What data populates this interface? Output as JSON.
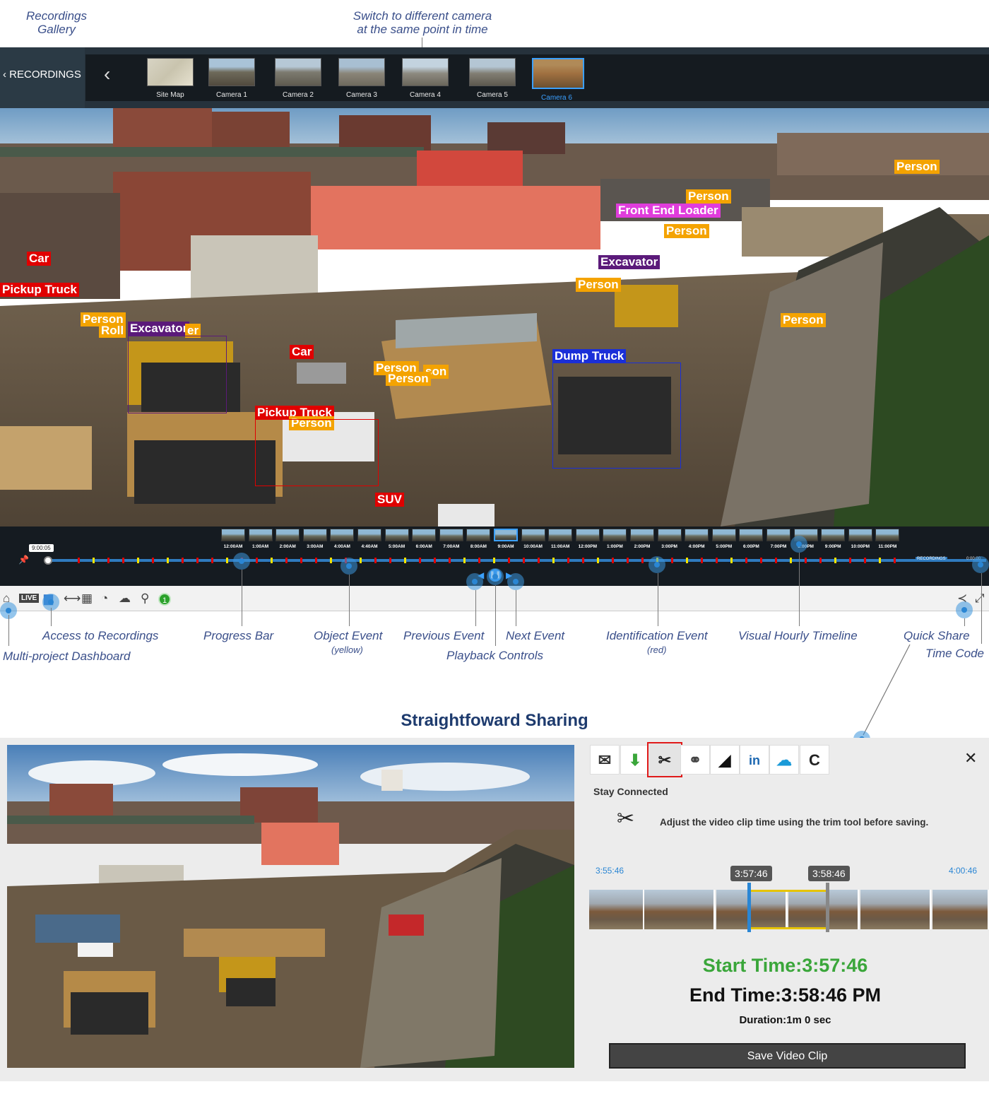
{
  "callouts": {
    "recordings_gallery": "Recordings\nGallery",
    "switch_camera": "Switch to different camera\nat the same point in time",
    "access_recordings": "Access to Recordings",
    "multi_project": "Multi-project Dashboard",
    "progress_bar": "Progress Bar",
    "object_event": "Object Event",
    "object_event_sub": "(yellow)",
    "previous_event": "Previous Event",
    "playback_controls": "Playback Controls",
    "next_event": "Next Event",
    "identification_event": "Identification Event",
    "identification_event_sub": "(red)",
    "visual_hourly": "Visual Hourly Timeline",
    "quick_share": "Quick Share",
    "time_code": "Time Code"
  },
  "topbar": {
    "recordings_label": "RECORDINGS",
    "cameras": [
      {
        "label": "Site Map"
      },
      {
        "label": "Camera 1"
      },
      {
        "label": "Camera 2"
      },
      {
        "label": "Camera 3"
      },
      {
        "label": "Camera 4"
      },
      {
        "label": "Camera 5"
      },
      {
        "label": "Camera 6"
      }
    ],
    "active_camera": "Camera 6"
  },
  "detections": [
    {
      "label": "Person",
      "color": "orange"
    },
    {
      "label": "Person",
      "color": "orange"
    },
    {
      "label": "Front End Loader",
      "color": "pink"
    },
    {
      "label": "Person",
      "color": "orange"
    },
    {
      "label": "Car",
      "color": "red"
    },
    {
      "label": "Excavator",
      "color": "purple"
    },
    {
      "label": "Pickup Truck",
      "color": "red"
    },
    {
      "label": "Person",
      "color": "orange"
    },
    {
      "label": "Person",
      "color": "orange"
    },
    {
      "label": "Person",
      "color": "orange"
    },
    {
      "label": "Roll",
      "color": "orange"
    },
    {
      "label": "Excavator",
      "color": "purple"
    },
    {
      "label": "er",
      "color": "orange"
    },
    {
      "label": "Car",
      "color": "red"
    },
    {
      "label": "Person",
      "color": "orange"
    },
    {
      "label": "son",
      "color": "orange"
    },
    {
      "label": "Person",
      "color": "orange"
    },
    {
      "label": "Dump Truck",
      "color": "blue"
    },
    {
      "label": "Pickup Truck",
      "color": "red"
    },
    {
      "label": "Person",
      "color": "orange"
    },
    {
      "label": "SUV",
      "color": "red"
    }
  ],
  "timeline": {
    "time_code": "9:00:05",
    "hours": [
      "12:00AM",
      "1:00AM",
      "2:00AM",
      "3:00AM",
      "4:00AM",
      "4:40AM",
      "5:00AM",
      "6:00AM",
      "7:00AM",
      "8:00AM",
      "9:00AM",
      "10:00AM",
      "11:00AM",
      "12:00PM",
      "1:00PM",
      "2:00PM",
      "3:00PM",
      "4:00PM",
      "5:00PM",
      "6:00PM",
      "7:00PM",
      "8:00PM",
      "9:00PM",
      "10:00PM",
      "11:00PM"
    ],
    "active_hour": "9:00AM",
    "recordings_tag": "RECORDINGS",
    "end_code": "0:00:00",
    "progress": 0.0
  },
  "toolbar": {
    "live_label": "LIVE",
    "badge": "1"
  },
  "share": {
    "title": "Straightfoward Sharing",
    "stay_connected": "Stay Connected",
    "instruction": "Adjust the video clip time using the trim tool before saving.",
    "range_start": "3:55:46",
    "range_end": "4:00:46",
    "trim_start_tag": "3:57:46",
    "trim_end_tag": "3:58:46",
    "start_time": "Start Time:3:57:46",
    "end_time": "End Time:3:58:46 PM",
    "duration_label": "Duration:",
    "duration_value": "1m 0 sec",
    "save_label": "Save Video Clip",
    "close": "✕"
  },
  "colors": {
    "accent": "#3ba0ff",
    "callout_text": "#3a4f8a",
    "object_event": "#f4e400",
    "identification_event": "#e00000",
    "start_time": "#3aa63a"
  }
}
